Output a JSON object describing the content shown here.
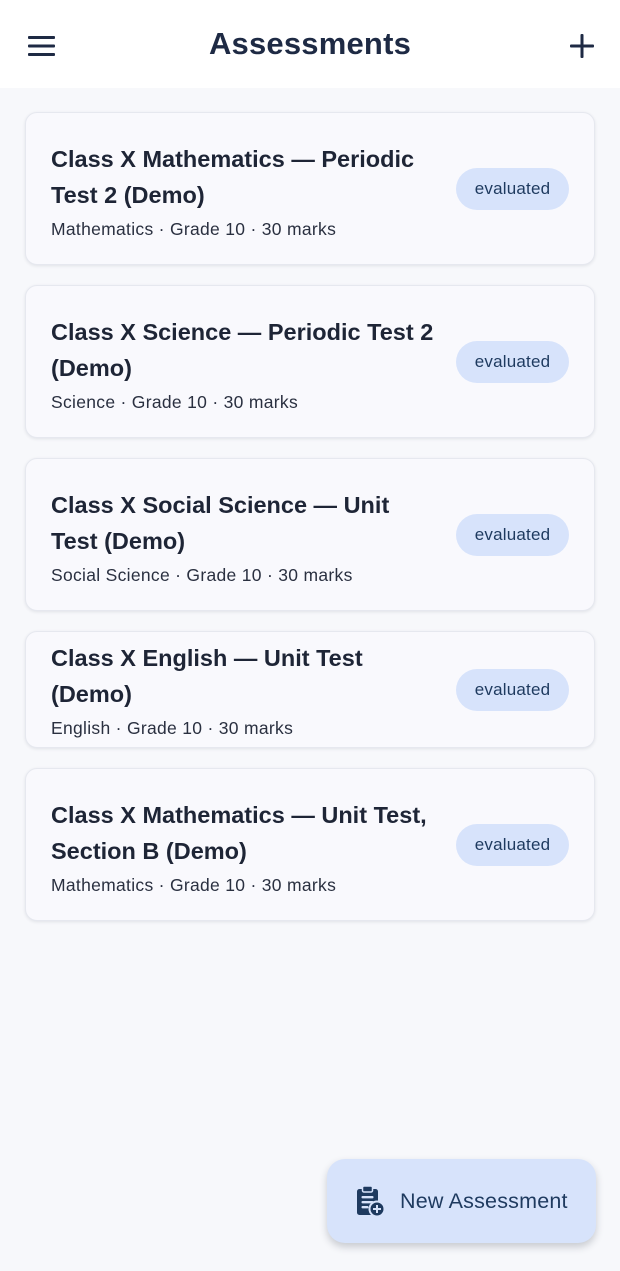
{
  "appbar": {
    "title": "Assessments",
    "menu_icon": "menu-icon",
    "add_icon": "plus-icon"
  },
  "assessments": [
    {
      "title": "Class X Mathematics — Periodic Test 2 (Demo)",
      "meta": "Mathematics · Grade 10 · 30 marks",
      "status": "evaluated"
    },
    {
      "title": "Class X Science — Periodic Test 2 (Demo)",
      "meta": "Science · Grade 10 · 30 marks",
      "status": "evaluated"
    },
    {
      "title": "Class X Social Science — Unit Test (Demo)",
      "meta": "Social Science · Grade 10 · 30 marks",
      "status": "evaluated"
    },
    {
      "title": "Class X English — Unit Test (Demo)",
      "meta": "English · Grade 10 · 30 marks",
      "status": "evaluated"
    },
    {
      "title": "Class X Mathematics — Unit Test, Section B (Demo)",
      "meta": "Mathematics · Grade 10 · 30 marks",
      "status": "evaluated"
    }
  ],
  "fab": {
    "label": "New Assessment",
    "icon": "clipboard-add-icon"
  },
  "colors": {
    "background": "#f7f8fb",
    "badge_bg": "#d7e3fb",
    "badge_text": "#1e3a5f",
    "title_text": "#1e2a44"
  }
}
